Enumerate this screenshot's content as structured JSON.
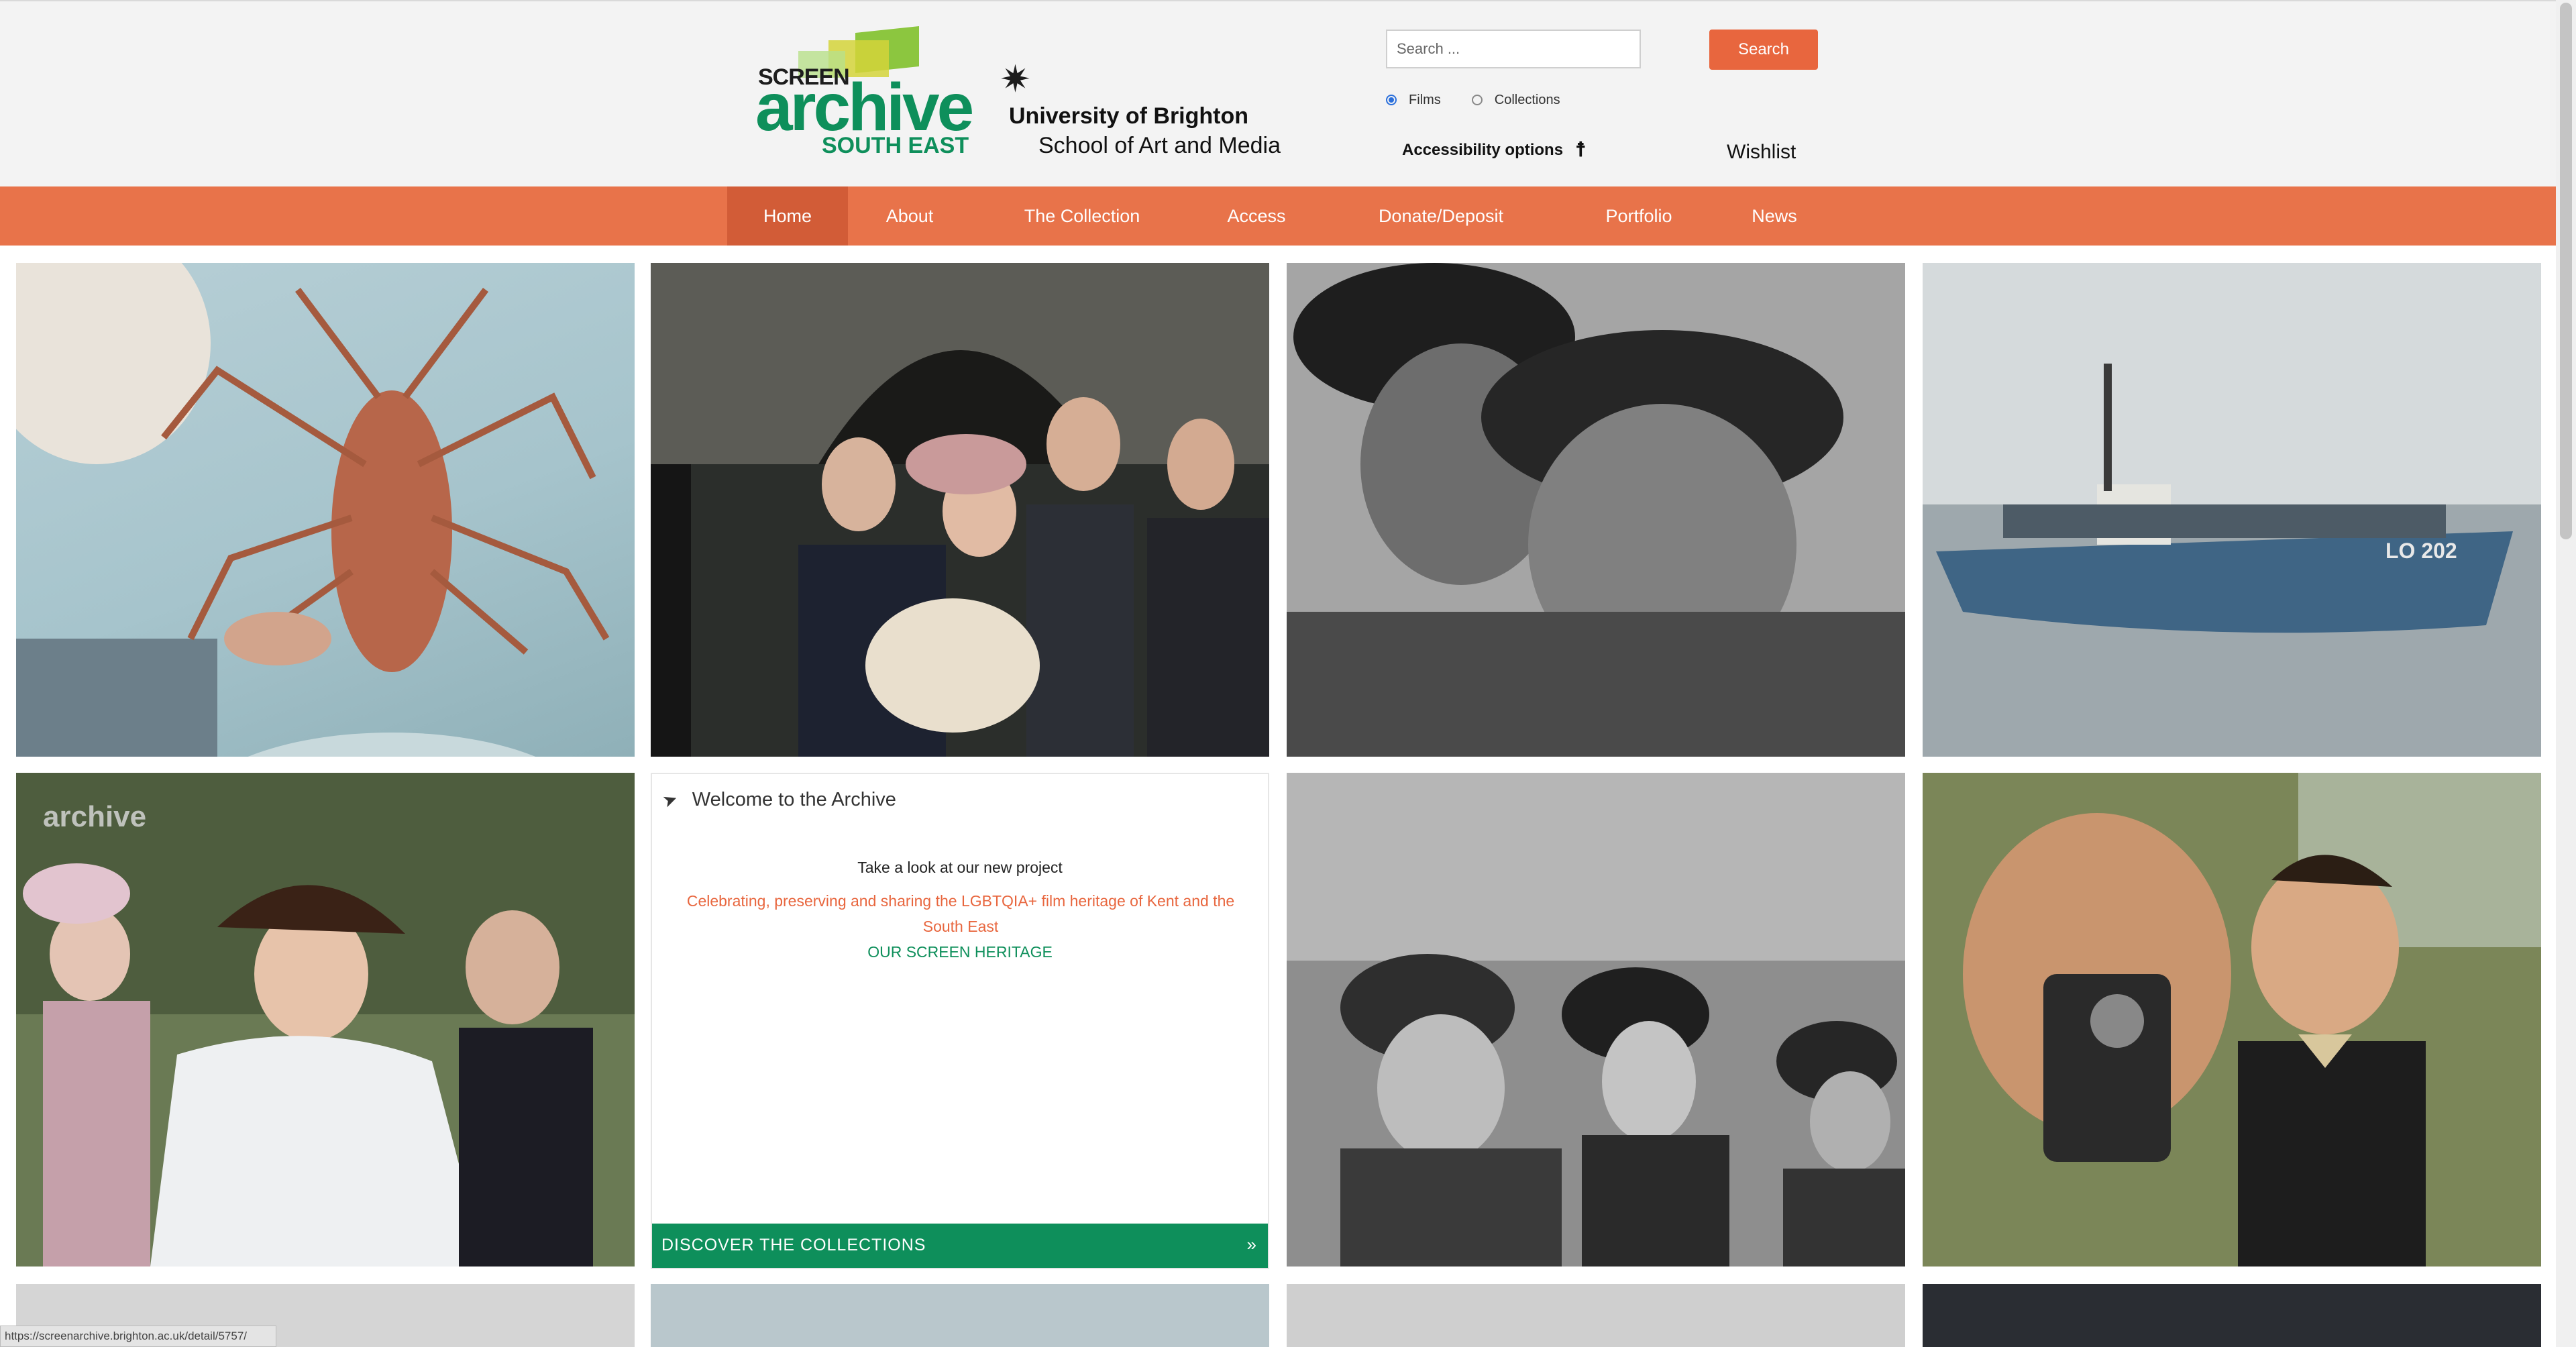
{
  "logo": {
    "screen_word": "SCREEN",
    "archive_word": "archive",
    "region_word": "SOUTH EAST",
    "brand_green": "#0e8f5b"
  },
  "university": {
    "line1": "University of Brighton",
    "line2": "School of Art and Media"
  },
  "search": {
    "placeholder": "Search ...",
    "button_label": "Search",
    "options": [
      {
        "label": "Films",
        "selected": true
      },
      {
        "label": "Collections",
        "selected": false
      }
    ]
  },
  "accessibility_label": "Accessibility options",
  "wishlist_label": "Wishlist",
  "nav": {
    "accent": "#e8734a",
    "active": "Home",
    "items": [
      {
        "label": "Home"
      },
      {
        "label": "About"
      },
      {
        "label": "The Collection"
      },
      {
        "label": "Access"
      },
      {
        "label": "Donate/Deposit"
      },
      {
        "label": "Portfolio"
      },
      {
        "label": "News"
      }
    ]
  },
  "welcome": {
    "title": "Welcome to the Archive",
    "intro": "Take a look at our new project",
    "project_link": "Celebrating, preserving and sharing the LGBTQIA+ film heritage of Kent and the South East",
    "heritage_link": "OUR SCREEN HERITAGE",
    "discover_label": "DISCOVER THE COLLECTIONS",
    "discover_arrow": "»"
  },
  "tiles": [
    {
      "name": "film-still-lobster",
      "watermark": ""
    },
    {
      "name": "film-still-christening",
      "watermark": ""
    },
    {
      "name": "film-still-fishermen",
      "watermark": ""
    },
    {
      "name": "film-still-boat",
      "watermark": "LO 202"
    },
    {
      "name": "film-still-wedding",
      "watermark": ""
    },
    {
      "name": "film-still-crowd",
      "watermark": ""
    },
    {
      "name": "film-still-camera",
      "watermark": ""
    }
  ],
  "status_url": "https://screenarchive.brighton.ac.uk/detail/5757/"
}
